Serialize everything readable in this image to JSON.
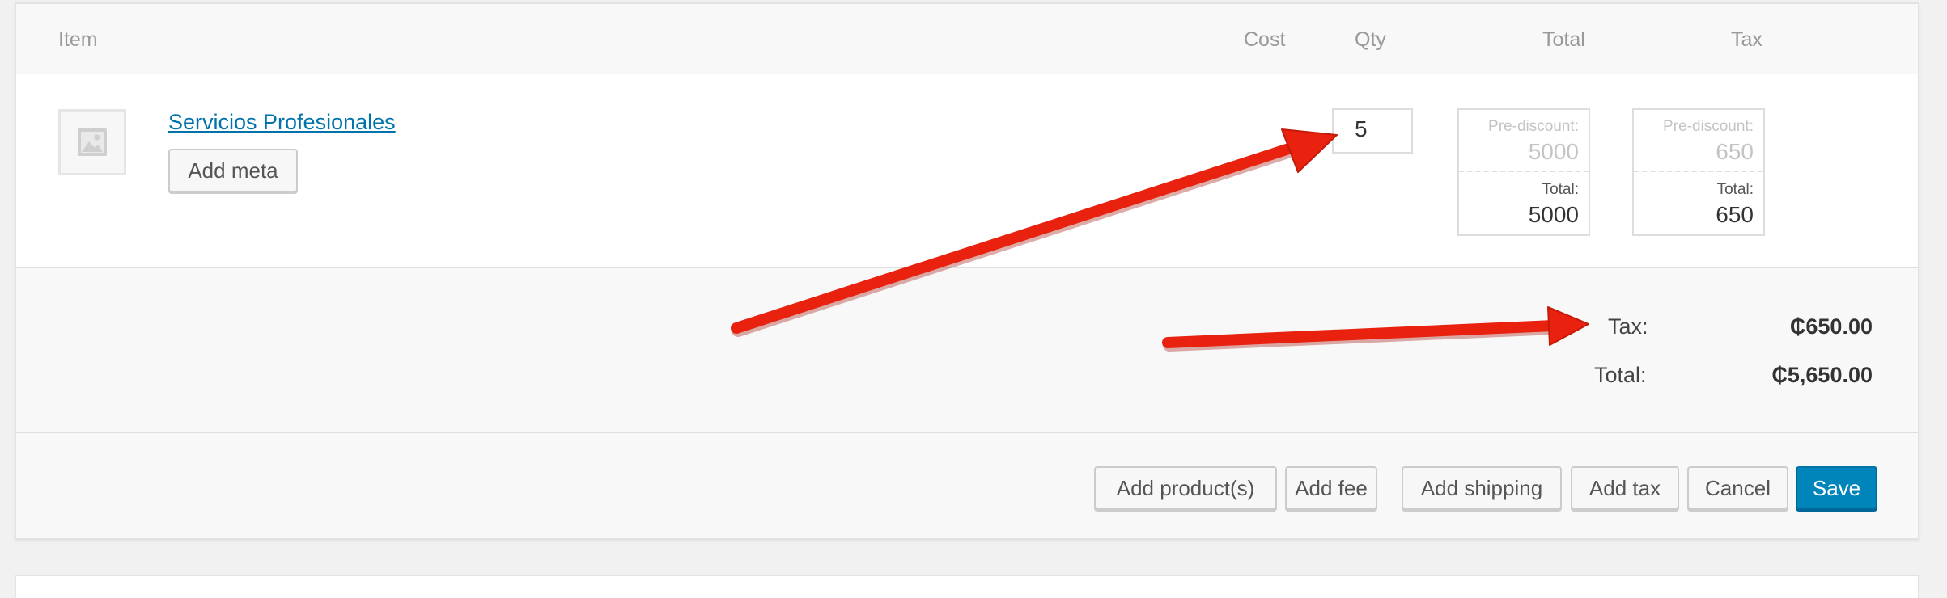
{
  "table": {
    "headers": {
      "item": "Item",
      "cost": "Cost",
      "qty": "Qty",
      "total": "Total",
      "tax": "Tax"
    }
  },
  "line_item": {
    "name": "Servicios Profesionales",
    "add_meta_label": "Add meta",
    "qty_value": "5",
    "total": {
      "pre_label": "Pre-discount:",
      "pre_value": "5000",
      "total_label": "Total:",
      "total_value": "5000"
    },
    "tax": {
      "pre_label": "Pre-discount:",
      "pre_value": "650",
      "total_label": "Total:",
      "total_value": "650"
    }
  },
  "totals": {
    "tax_label": "Tax:",
    "tax_value": "₵650.00",
    "total_label": "Total:",
    "total_value": "₵5,650.00"
  },
  "actions": {
    "add_products": "Add product(s)",
    "add_fee": "Add fee",
    "add_shipping": "Add shipping",
    "add_tax": "Add tax",
    "cancel": "Cancel",
    "save": "Save"
  },
  "icons": {
    "thumbnail": "image-placeholder-icon"
  },
  "colors": {
    "link": "#0073aa",
    "primary_button": "#0085ba",
    "annotation_arrow": "#e8220e"
  }
}
